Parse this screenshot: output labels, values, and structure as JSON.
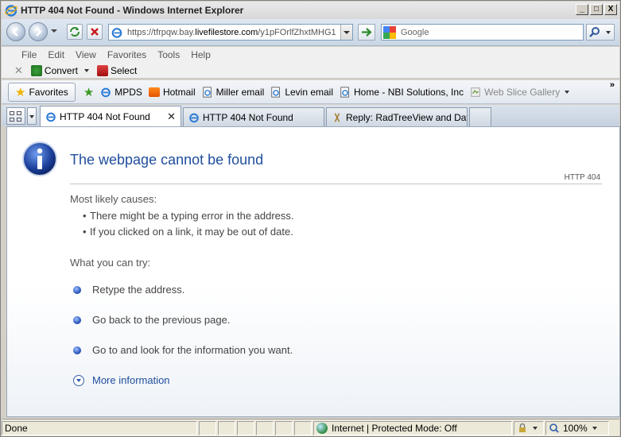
{
  "window": {
    "title": "HTTP 404 Not Found - Windows Internet Explorer",
    "minimize": "_",
    "maximize": "□",
    "close": "X"
  },
  "address": {
    "url_prefix": "https://tfrpqw.bay.",
    "url_domain": "livefilestore.com",
    "url_suffix": "/y1pFOrlfZhxtMHG1",
    "search_placeholder": "Google"
  },
  "menu": [
    "File",
    "Edit",
    "View",
    "Favorites",
    "Tools",
    "Help"
  ],
  "command_bar": {
    "stop": "✕",
    "convert": "Convert",
    "select": "Select"
  },
  "favorites_bar": {
    "favorites_label": "Favorites",
    "links": [
      "MPDS",
      "Hotmail",
      "Miller email",
      "Levin email",
      "Home - NBI Solutions, Inc",
      "Web Slice Gallery"
    ],
    "overflow": "»"
  },
  "tabs": [
    {
      "label": "HTTP 404 Not Found",
      "active": true
    },
    {
      "label": "HTTP 404 Not Found",
      "active": false
    },
    {
      "label": "Reply: RadTreeView and Dat...",
      "active": false
    }
  ],
  "page": {
    "title": "The webpage cannot be found",
    "http_code": "HTTP 404",
    "causes_title": "Most likely causes:",
    "causes": [
      "There might be a typing error in the address.",
      "If you clicked on a link, it may be out of date."
    ],
    "try_title": "What you can try:",
    "try_items": [
      "Retype the address.",
      "Go back to the previous page.",
      "Go to  and look for the information you want."
    ],
    "more_info": "More information"
  },
  "status": {
    "text": "Done",
    "zone": "Internet | Protected Mode: Off",
    "zoom": "100%"
  },
  "colors": {
    "title_blue": "#1f4e9c",
    "link_blue": "#1f4e9c"
  }
}
